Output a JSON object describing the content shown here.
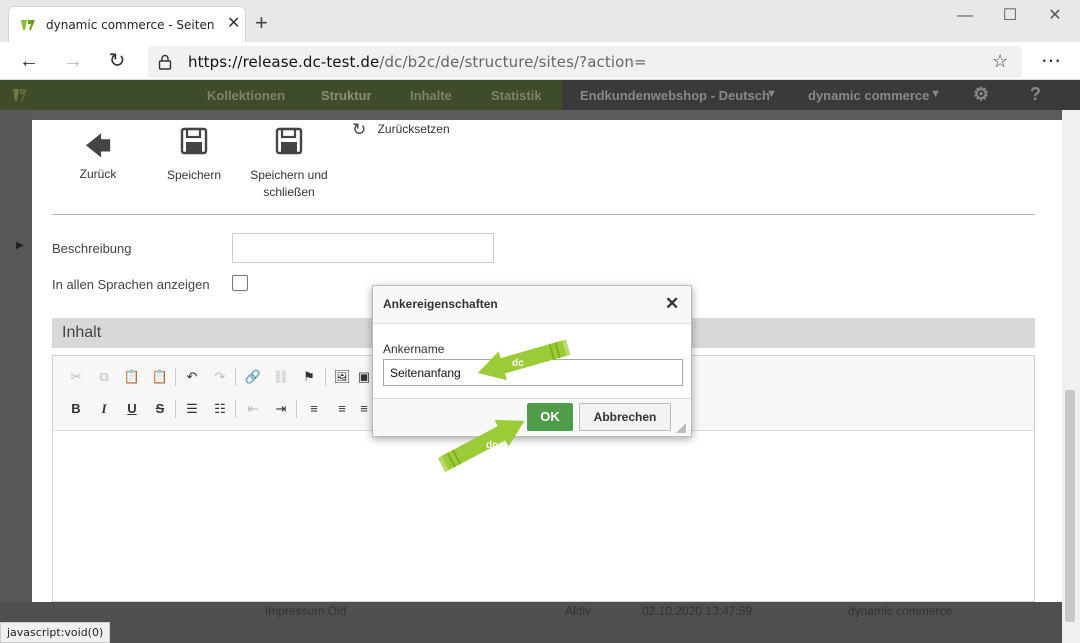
{
  "browser": {
    "tab_title": "dynamic commerce - Seiten",
    "url_domain": "https://release.dc-test.de",
    "url_path": "/dc/b2c/de/structure/sites/?action=",
    "status_text": "javascript:void(0)"
  },
  "appnav": {
    "items": [
      "Kollektionen",
      "Struktur",
      "Inhalte",
      "Statistik"
    ],
    "shop": "Endkundenwebshop - Deutsch",
    "company": "dynamic commerce",
    "help": "?"
  },
  "toolbar": {
    "back_label": "Zurück",
    "save_label": "Speichern",
    "save_close_label": "Speichern und schließen",
    "reset_label": "Zurücksetzen"
  },
  "form": {
    "beschreibung_label": "Beschreibung",
    "lang_label": "In allen Sprachen anzeigen",
    "lang_checked": false,
    "inhalt_title": "Inhalt"
  },
  "background_row": {
    "name": "Impressum Old",
    "status": "Aktiv",
    "date": "02.10.2020 13:47:59",
    "owner": "dynamic commerce"
  },
  "dialog": {
    "title": "Ankereigenschaften",
    "field_label": "Ankername",
    "field_value": "Seitenanfang",
    "ok_label": "OK",
    "cancel_label": "Abbrechen"
  },
  "colors": {
    "ok_green": "#4f9c4a",
    "arrow_green": "#9ccb38",
    "nav_bg": "#3f4c2a"
  }
}
